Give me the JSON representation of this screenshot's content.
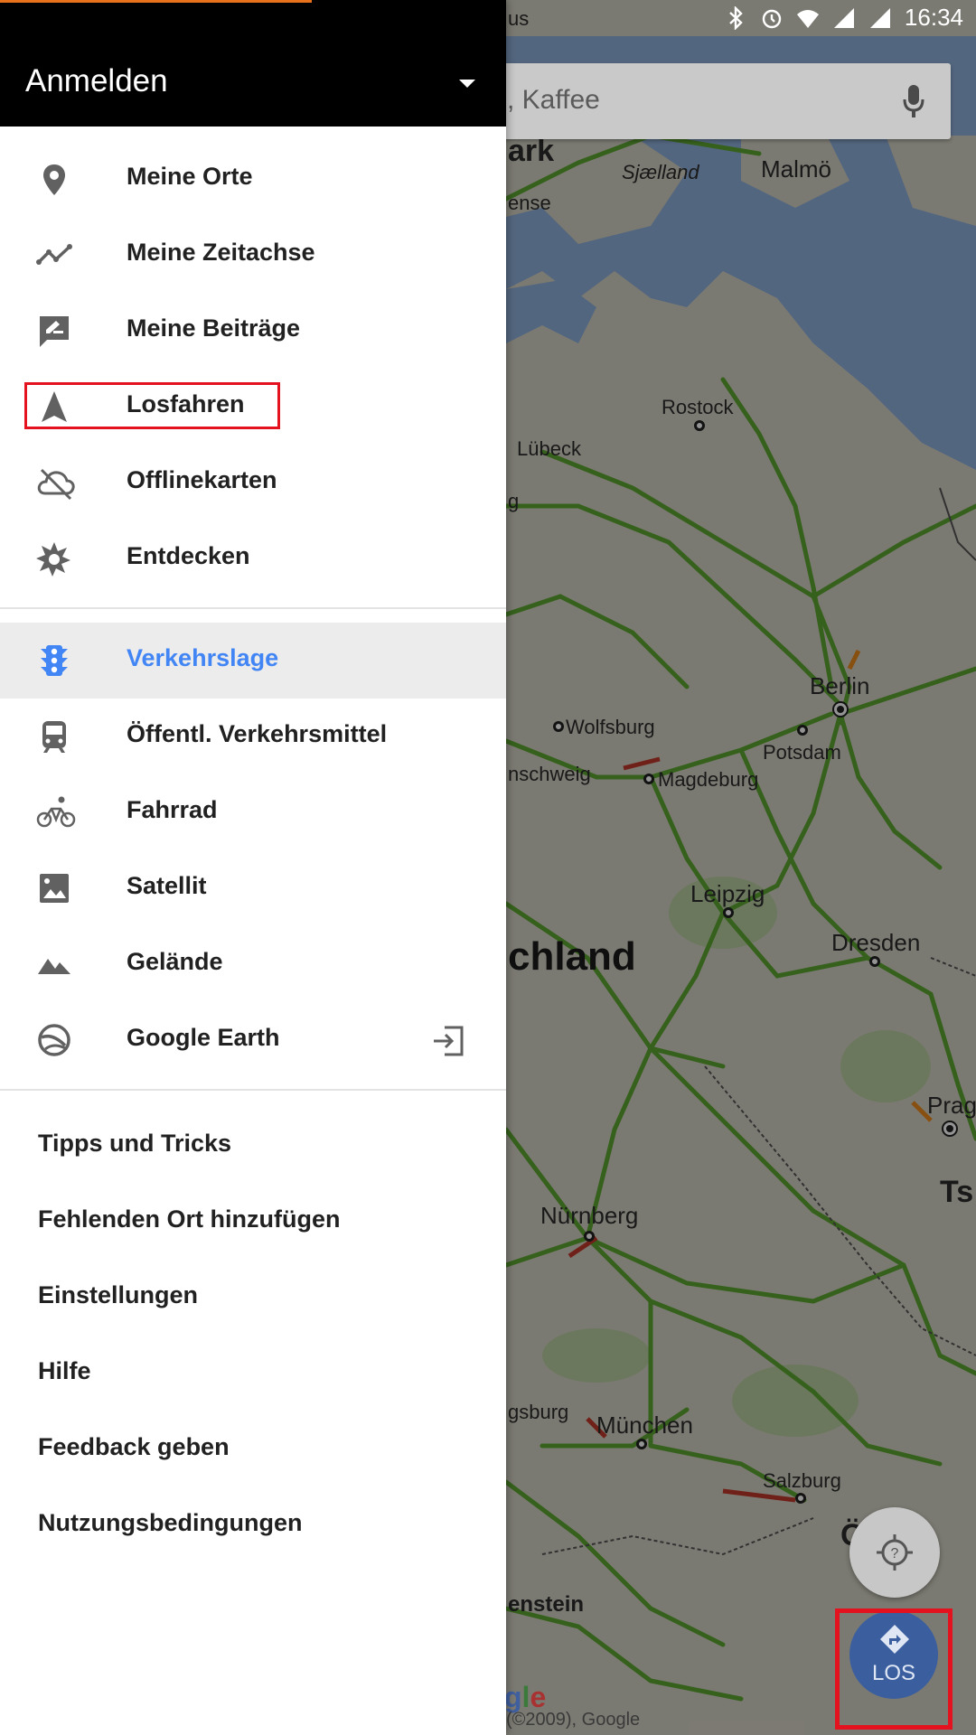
{
  "status_bar": {
    "time": "16:34",
    "icons": [
      "bluetooth-icon",
      "alarm-icon",
      "wifi-icon",
      "signal-icon",
      "signal-icon-2"
    ]
  },
  "map": {
    "search_placeholder": "s, Kaffee",
    "labels": {
      "malmo": "Malmö",
      "sjaelland": "Sjælland",
      "ark": "ark",
      "ense": "ense",
      "us": "us",
      "rostock": "Rostock",
      "lubeck": "Lübeck",
      "g": "g",
      "berlin": "Berlin",
      "wolfsburg": "Wolfsburg",
      "potsdam": "Potsdam",
      "nschweig": "nschweig",
      "magdeburg": "Magdeburg",
      "leipzig": "Leipzig",
      "dresden": "Dresden",
      "chland": "chland",
      "prag": "Prag",
      "ts": "Ts",
      "nurnberg": "Nürnberg",
      "gsburg": "gsburg",
      "munchen": "München",
      "salzburg": "Salzburg",
      "osterreich": "Ö eic",
      "enstein": "enstein"
    },
    "google_logo": "gle",
    "copyright": "(©2009), Google",
    "los_button": "LOS"
  },
  "drawer": {
    "header_title": "Anmelden",
    "section1": [
      {
        "label": "Meine Orte",
        "icon": "place-pin-icon"
      },
      {
        "label": "Meine Zeitachse",
        "icon": "timeline-icon"
      },
      {
        "label": "Meine Beiträge",
        "icon": "contributions-icon"
      },
      {
        "label": "Losfahren",
        "icon": "navigation-arrow-icon"
      },
      {
        "label": "Offlinekarten",
        "icon": "cloud-off-icon"
      },
      {
        "label": "Entdecken",
        "icon": "explore-icon"
      }
    ],
    "section2": [
      {
        "label": "Verkehrslage",
        "icon": "traffic-icon",
        "active": true
      },
      {
        "label": "Öffentl. Verkehrsmittel",
        "icon": "transit-icon"
      },
      {
        "label": "Fahrrad",
        "icon": "bike-icon"
      },
      {
        "label": "Satellit",
        "icon": "satellite-icon"
      },
      {
        "label": "Gelände",
        "icon": "terrain-icon"
      },
      {
        "label": "Google Earth",
        "icon": "earth-icon"
      }
    ],
    "section3": [
      "Tipps und Tricks",
      "Fehlenden Ort hinzufügen",
      "Einstellungen",
      "Hilfe",
      "Feedback geben",
      "Nutzungsbedingungen"
    ],
    "colors": {
      "active_text": "#4285f4",
      "highlight_box": "#e4121e",
      "header_bg": "#000000",
      "accent": "#e8711c"
    }
  }
}
